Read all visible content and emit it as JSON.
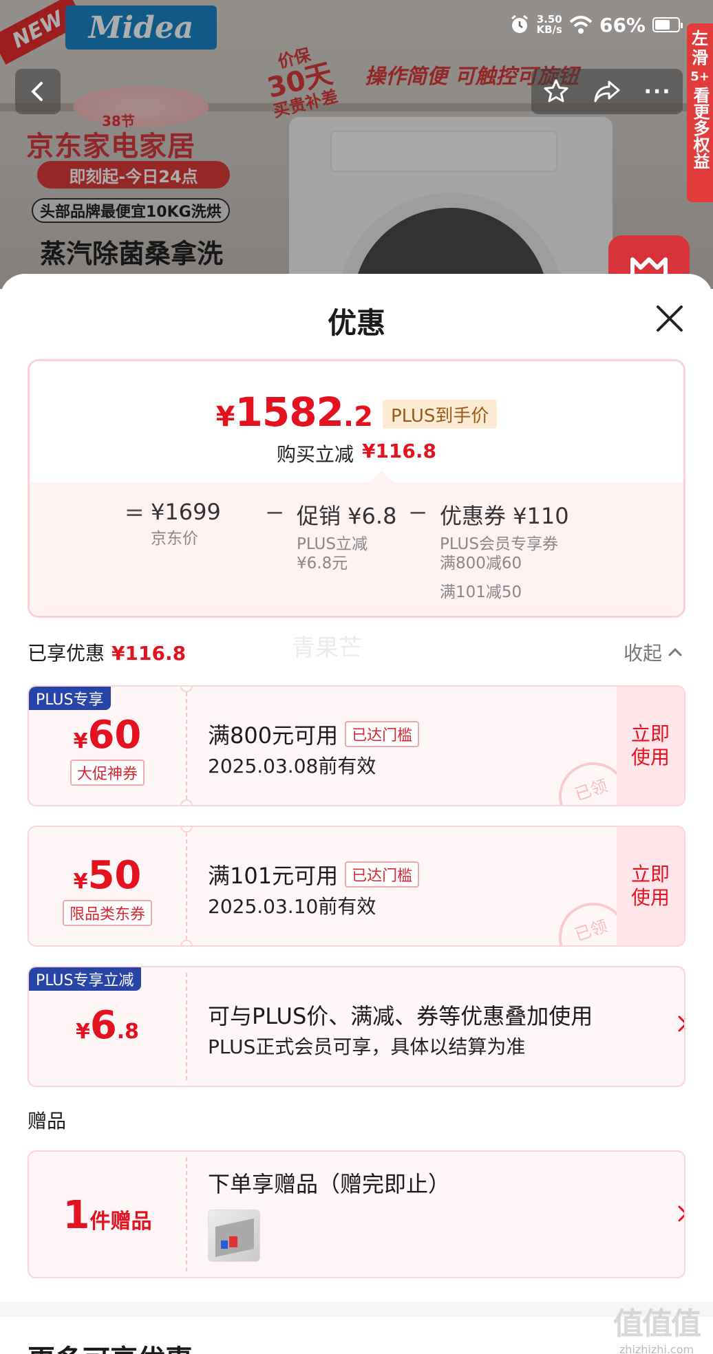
{
  "status_bar": {
    "net_rate_value": "3.50",
    "net_rate_unit": "KB/s",
    "battery_percent": "66%",
    "battery_level": 0.66
  },
  "product_banner": {
    "new_badge": "NEW",
    "brand": "Midea",
    "price_protect_line1": "价保",
    "price_protect_line2": "30天",
    "price_protect_line3": "买贵补差",
    "operation_text": "操作简便 可触控可旋钮",
    "festival": "38节",
    "jd_title": "京东家电家居",
    "jd_subtitle": "即刻起-今日24点",
    "brand_pill": "头部品牌最便宜10KG洗烘",
    "steam_text": "蒸汽除菌桑拿洗",
    "side_strip_line1": "左滑",
    "side_strip_plus": "5+",
    "side_strip_line2": "看更多权益"
  },
  "sheet": {
    "title": "优惠"
  },
  "price_card": {
    "currency": "¥",
    "price_int": "1582",
    "price_dec": ".2",
    "plus_tag": "PLUS到手价",
    "reduce_label": "购买立减",
    "reduce_value": "¥116.8",
    "equals": "=",
    "minus": "−",
    "jd_price_value": "¥1699",
    "jd_price_label": "京东价",
    "promo_value": "促销 ¥6.8",
    "promo_label": "PLUS立减",
    "promo_sub": "¥6.8元",
    "coupon_value": "优惠券 ¥110",
    "coupon_label": "PLUS会员专享券",
    "coupon_sub1": "满800减60",
    "coupon_sub2": "满101减50"
  },
  "applied": {
    "label": "已享优惠",
    "value": "¥116.8",
    "collapse": "收起",
    "watermark": "青果芒"
  },
  "coupons": [
    {
      "badge": "PLUS专享",
      "currency": "¥",
      "amount": "60",
      "tag": "大促神券",
      "title": "满800元可用",
      "met": "已达门槛",
      "date": "2025.03.08前有效",
      "use_line1": "立即",
      "use_line2": "使用",
      "stamp": "已领"
    },
    {
      "currency": "¥",
      "amount": "50",
      "tag": "限品类东券",
      "title": "满101元可用",
      "met": "已达门槛",
      "date": "2025.03.10前有效",
      "use_line1": "立即",
      "use_line2": "使用",
      "stamp": "已领"
    }
  ],
  "plus_reduce": {
    "badge": "PLUS专享立减",
    "currency": "¥",
    "amount": "6",
    "decimal": ".8",
    "title": "可与PLUS价、满减、券等优惠叠加使用",
    "subtitle": "PLUS正式会员可享，具体以结算为准"
  },
  "gift": {
    "section_title": "赠品",
    "count": "1",
    "count_label": "件赠品",
    "title": "下单享赠品（赠完即止）"
  },
  "more": {
    "title": "更多可享优惠"
  },
  "site_watermark": {
    "logo": "值值值",
    "url": "zhizhizhi.com"
  },
  "icons": {
    "back": "back-arrow-icon",
    "favorite": "star-icon",
    "share": "share-icon",
    "more": "more-dots-icon",
    "close": "close-icon",
    "collapse": "chevron-up-icon",
    "row_arrow": "chevron-right-icon"
  },
  "colors": {
    "accent_red": "#e4121f",
    "plus_blue": "#2744a6",
    "card_pink": "#fff6f7",
    "card_border": "#fbd3d8"
  }
}
